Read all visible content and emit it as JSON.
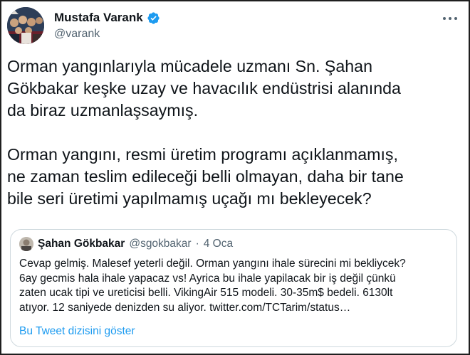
{
  "author": {
    "name": "Mustafa Varank",
    "handle": "@varank",
    "verified": true
  },
  "tweet": {
    "text": "Orman yangınlarıyla mücadele uzmanı Sn. Şahan\nGökbakar keşke uzay ve havacılık endüstrisi alanında\nda biraz uzmanlaşsaymış.\n\nOrman yangını, resmi üretim programı açıklanmamış,\nne zaman teslim edileceği belli olmayan, daha bir tane\nbile seri üretimi yapılmamış uçağı mı bekleyecek?"
  },
  "quote": {
    "name": "Şahan Gökbakar",
    "handle": "@sgokbakar",
    "separator": "·",
    "date": "4 Oca",
    "text": "Cevap gelmiş. Malesef yeterli değil. Orman yangını ihale sürecini mi bekliycek?\n6ay gecmis hala ihale yapacaz vs! Ayrica bu ihale yapilacak bir iş değil çünkü\nzaten ucak tipi ve ureticisi belli. VikingAir 515 modeli. 30-35m$ bedeli. 6130lt\natıyor. 12 saniyede denizden su aliyor. twitter.com/TCTarim/status…",
    "show_thread": "Bu Tweet dizisini göster"
  },
  "icons": {
    "verified": "verified-badge-icon",
    "more": "more-options-icon"
  },
  "colors": {
    "link": "#1d9bf0",
    "secondary_text": "#536471",
    "border": "#cfd9de"
  }
}
